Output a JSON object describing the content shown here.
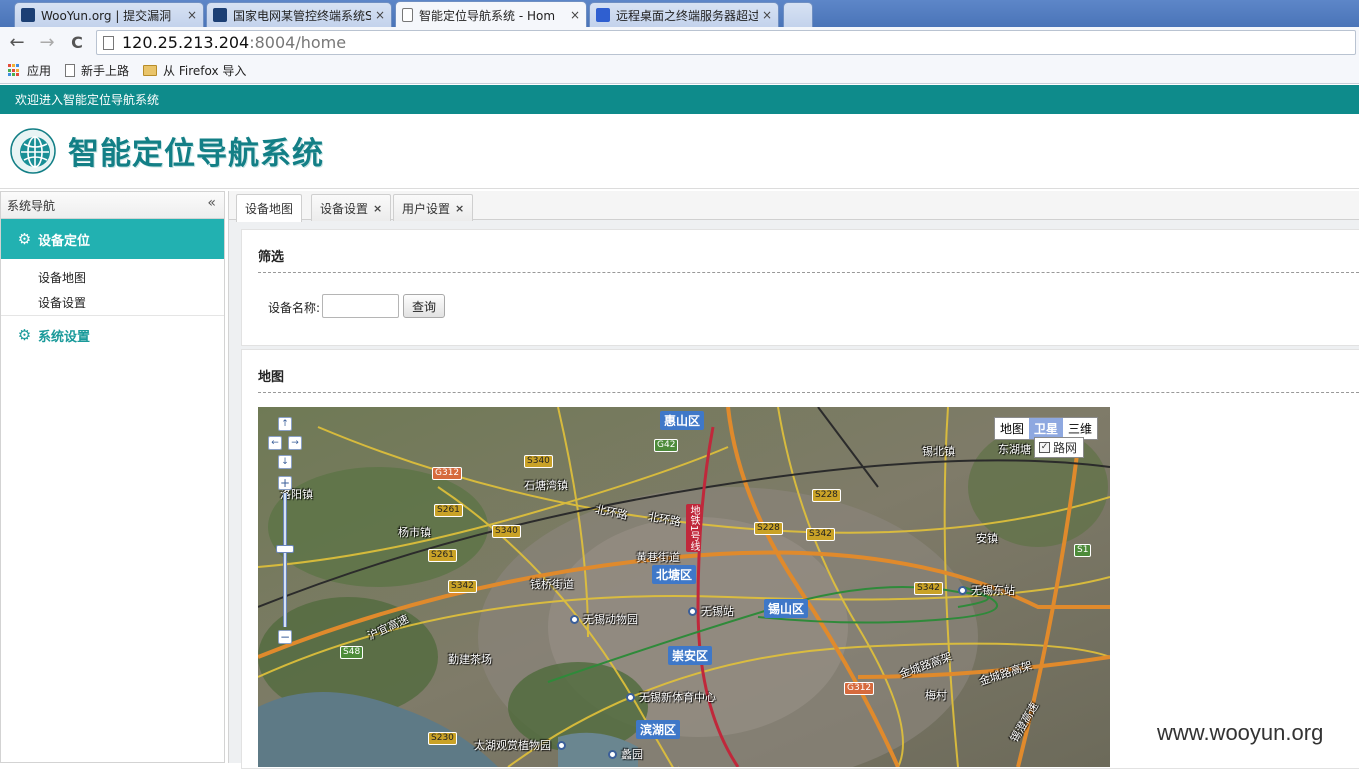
{
  "browser": {
    "tabs": [
      {
        "title": "WooYun.org | 提交漏洞",
        "favicon_color": "#1c3f74",
        "active": false
      },
      {
        "title": "国家电网某管控终端系统S",
        "favicon_color": "#1c3f74",
        "active": false
      },
      {
        "title": "智能定位导航系统 - Hom",
        "favicon_color": "#ffffff",
        "active": true
      },
      {
        "title": "远程桌面之终端服务器超过",
        "favicon_color": "#2f5fd0",
        "active": false
      }
    ],
    "close_glyph": "×",
    "back_glyph": "←",
    "forward_glyph": "→",
    "reload_glyph": "C",
    "url_host": "120.25.213.204",
    "url_rest": ":8004/home",
    "bookmarks": [
      {
        "label": "应用",
        "icon": "apps-grid-icon"
      },
      {
        "label": "新手上路",
        "icon": "page-icon"
      },
      {
        "label": "从 Firefox 导入",
        "icon": "folder-icon"
      }
    ]
  },
  "app": {
    "welcome_text": "欢迎进入智能定位导航系统",
    "system_title": "智能定位导航系统",
    "brand_color": "#0e8b8b",
    "sidebar": {
      "title": "系统导航",
      "collapse_glyph": "«",
      "groups": [
        {
          "label": "设备定位",
          "items": [
            "设备地图",
            "设备设置"
          ]
        },
        {
          "label": "系统设置",
          "items": []
        }
      ]
    },
    "content_tabs": [
      {
        "label": "设备地图",
        "closable": false
      },
      {
        "label": "设备设置",
        "closable": true
      },
      {
        "label": "用户设置",
        "closable": true
      }
    ],
    "tab_close_glyph": "×",
    "filter_panel": {
      "title": "筛选",
      "device_name_label": "设备名称:",
      "device_name_value": "",
      "query_button": "查询"
    },
    "map_panel": {
      "title": "地图",
      "map_types": [
        "地图",
        "卫星",
        "三维"
      ],
      "active_map_type": "卫星",
      "road_network_label": "路网",
      "road_network_checked": true,
      "districts": [
        "惠山区",
        "北塘区",
        "锡山区",
        "崇安区",
        "滨湖区"
      ],
      "places": [
        "石塘湾镇",
        "杨市镇",
        "钱桥街道",
        "黄巷街道",
        "锡北镇",
        "东湖塘",
        "安镇",
        "梅村",
        "勤建茶场",
        "洛阳镇"
      ],
      "pois": [
        "无锡动物园",
        "无锡站",
        "无锡东站",
        "无锡新体育中心",
        "太湖观赏植物园",
        "蠡园"
      ],
      "roads": [
        "北环路",
        "北环路",
        "沪宜高速",
        "金城路高架",
        "金城路高架",
        "锡澄高速"
      ],
      "metro_line": "地铁1号线",
      "shields": [
        {
          "code": "G42",
          "kind": "g"
        },
        {
          "code": "G312",
          "kind": "r"
        },
        {
          "code": "G312",
          "kind": "r"
        },
        {
          "code": "S340",
          "kind": "y"
        },
        {
          "code": "S340",
          "kind": "y"
        },
        {
          "code": "S261",
          "kind": "y"
        },
        {
          "code": "S261",
          "kind": "y"
        },
        {
          "code": "S342",
          "kind": "y"
        },
        {
          "code": "S342",
          "kind": "y"
        },
        {
          "code": "S342",
          "kind": "y"
        },
        {
          "code": "S228",
          "kind": "y"
        },
        {
          "code": "S228",
          "kind": "y"
        },
        {
          "code": "S48",
          "kind": "g"
        },
        {
          "code": "S230",
          "kind": "y"
        },
        {
          "code": "S1",
          "kind": "g"
        }
      ],
      "nav_glyphs": {
        "up": "↑",
        "left": "←",
        "right": "→",
        "down": "↓",
        "zoom_in": "+",
        "zoom_out": "−"
      }
    }
  },
  "watermark": "www.wooyun.org"
}
